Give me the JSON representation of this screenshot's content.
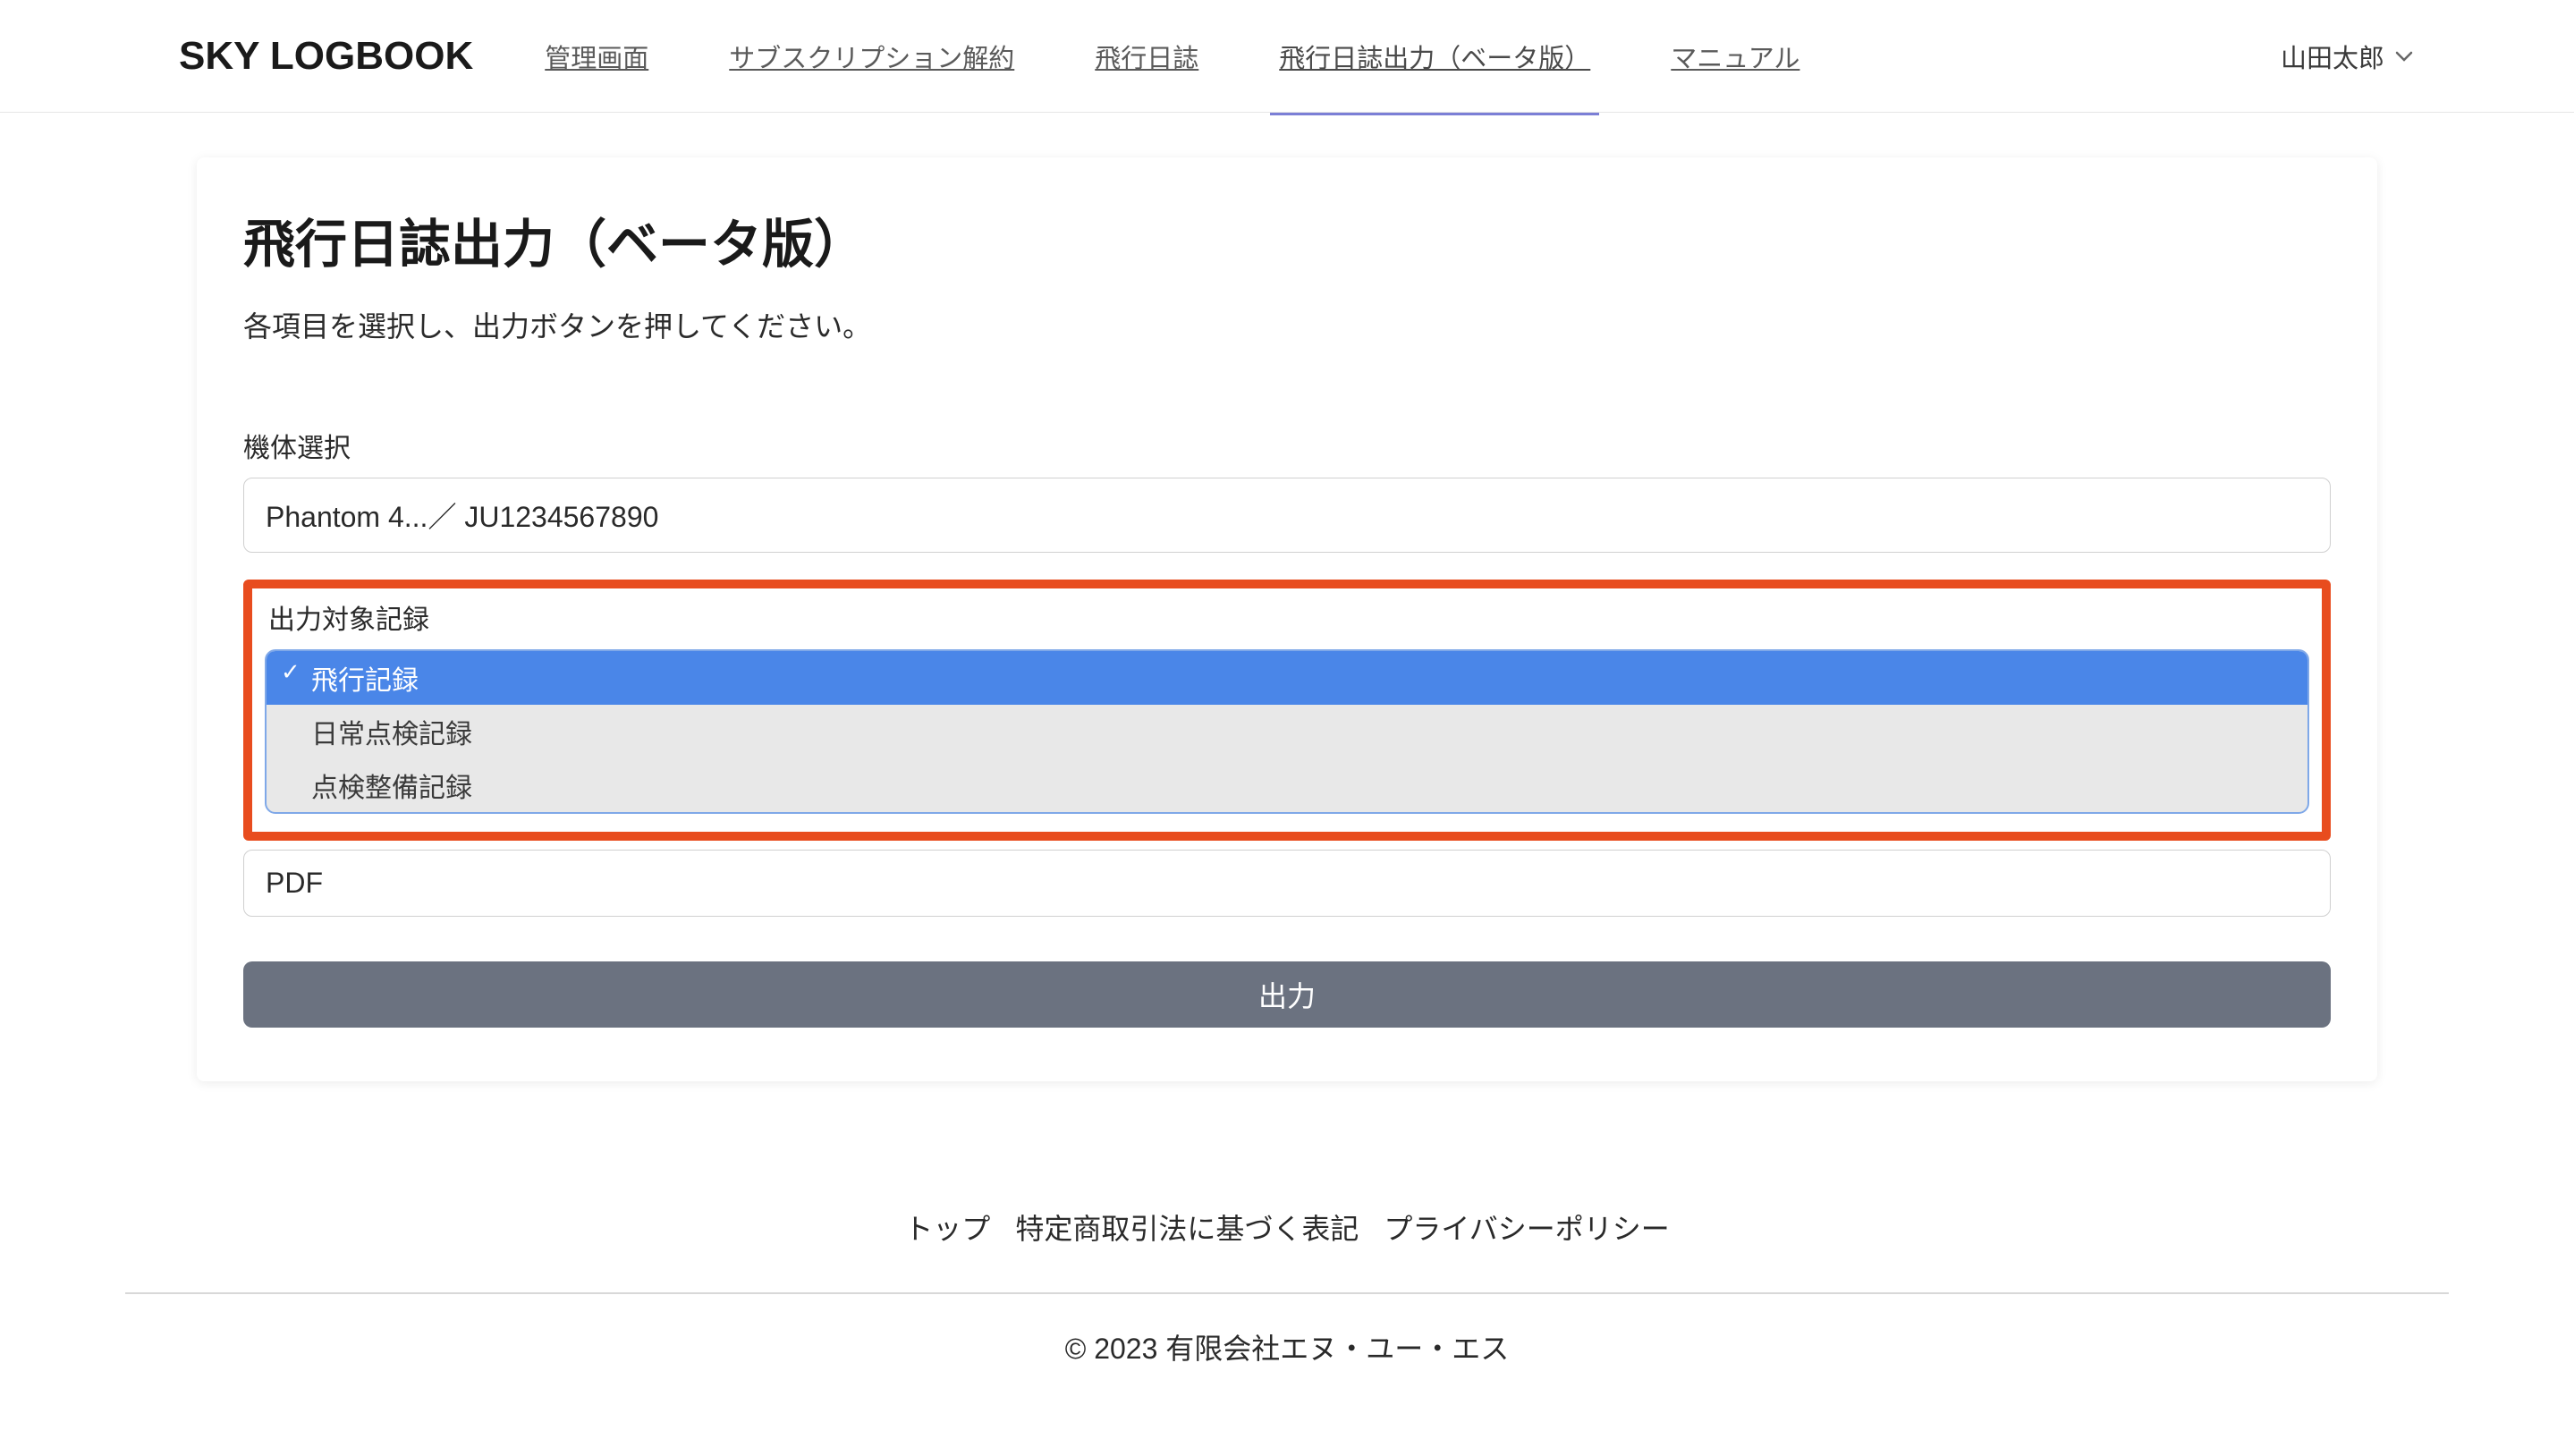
{
  "header": {
    "logo": "SKY LOGBOOK",
    "nav": [
      {
        "label": "管理画面",
        "active": false
      },
      {
        "label": "サブスクリプション解約",
        "active": false
      },
      {
        "label": "飛行日誌",
        "active": false
      },
      {
        "label": "飛行日誌出力（ベータ版）",
        "active": true
      },
      {
        "label": "マニュアル",
        "active": false
      }
    ],
    "user_name": "山田太郎"
  },
  "page": {
    "title": "飛行日誌出力（ベータ版）",
    "subtitle": "各項目を選択し、出力ボタンを押してください。"
  },
  "form": {
    "aircraft": {
      "label": "機体選択",
      "value": "Phantom 4...／ JU1234567890"
    },
    "record_type": {
      "label": "出力対象記録",
      "options": [
        {
          "label": "飛行記録",
          "selected": true
        },
        {
          "label": "日常点検記録",
          "selected": false
        },
        {
          "label": "点検整備記録",
          "selected": false
        }
      ]
    },
    "format": {
      "value": "PDF"
    },
    "submit_label": "出力"
  },
  "footer": {
    "links": [
      "トップ",
      "特定商取引法に基づく表記",
      "プライバシーポリシー"
    ],
    "copyright": "© 2023 有限会社エヌ・ユー・エス"
  }
}
